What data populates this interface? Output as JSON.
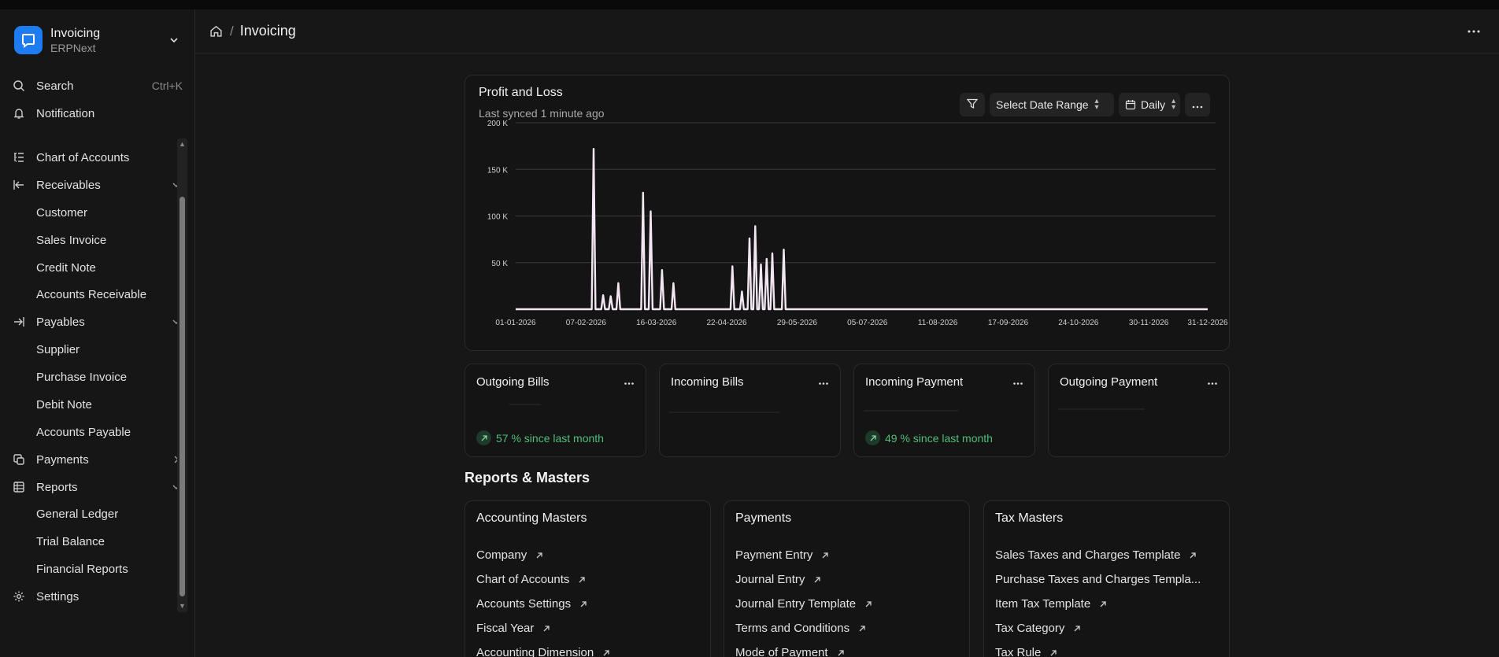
{
  "app": {
    "title": "Invoicing",
    "subtitle": "ERPNext"
  },
  "sidebar": {
    "search_label": "Search",
    "search_shortcut": "Ctrl+K",
    "notification_label": "Notification",
    "items": [
      {
        "label": "Chart of Accounts",
        "icon": "tree-icon",
        "level": 0
      },
      {
        "label": "Receivables",
        "icon": "arrow-left-bar-icon",
        "level": 0,
        "expanded": true
      },
      {
        "label": "Customer",
        "level": 1
      },
      {
        "label": "Sales Invoice",
        "level": 1
      },
      {
        "label": "Credit Note",
        "level": 1
      },
      {
        "label": "Accounts Receivable",
        "level": 1
      },
      {
        "label": "Payables",
        "icon": "arrow-right-bar-icon",
        "level": 0,
        "expanded": true
      },
      {
        "label": "Supplier",
        "level": 1
      },
      {
        "label": "Purchase Invoice",
        "level": 1
      },
      {
        "label": "Debit Note",
        "level": 1
      },
      {
        "label": "Accounts Payable",
        "level": 1
      },
      {
        "label": "Payments",
        "icon": "payments-icon",
        "level": 0,
        "expanded": false
      },
      {
        "label": "Reports",
        "icon": "table-icon",
        "level": 0,
        "expanded": true
      },
      {
        "label": "General Ledger",
        "level": 1
      },
      {
        "label": "Trial Balance",
        "level": 1
      },
      {
        "label": "Financial Reports",
        "level": 1
      },
      {
        "label": "Settings",
        "icon": "gear-icon",
        "level": 0
      }
    ]
  },
  "header": {
    "breadcrumb": "Invoicing"
  },
  "profit_loss": {
    "title": "Profit and Loss",
    "synced": "Last synced 1 minute ago",
    "date_range_label": "Select Date Range",
    "interval_label": "Daily"
  },
  "chart_data": {
    "type": "line",
    "title": "Profit and Loss",
    "x_range": [
      "01-01-2026",
      "31-12-2026"
    ],
    "x_tick_labels": [
      "01-01-2026",
      "07-02-2026",
      "16-03-2026",
      "22-04-2026",
      "29-05-2026",
      "05-07-2026",
      "11-08-2026",
      "17-09-2026",
      "24-10-2026",
      "30-11-2026",
      "31-12-2026"
    ],
    "y_tick_labels": [
      "50 K",
      "100 K",
      "150 K",
      "200 K"
    ],
    "ylim": [
      0,
      200000
    ],
    "grid": true,
    "series": [
      {
        "color": "#f3e6f3",
        "points": [
          [
            "01-01-2026",
            0
          ],
          [
            "10-02-2026",
            0
          ],
          [
            "11-02-2026",
            172000
          ],
          [
            "12-02-2026",
            0
          ],
          [
            "15-02-2026",
            0
          ],
          [
            "16-02-2026",
            15000
          ],
          [
            "17-02-2026",
            0
          ],
          [
            "19-02-2026",
            0
          ],
          [
            "20-02-2026",
            14000
          ],
          [
            "21-02-2026",
            0
          ],
          [
            "23-02-2026",
            0
          ],
          [
            "24-02-2026",
            28000
          ],
          [
            "25-02-2026",
            0
          ],
          [
            "08-03-2026",
            0
          ],
          [
            "09-03-2026",
            125000
          ],
          [
            "10-03-2026",
            0
          ],
          [
            "12-03-2026",
            0
          ],
          [
            "13-03-2026",
            105000
          ],
          [
            "14-03-2026",
            0
          ],
          [
            "18-03-2026",
            0
          ],
          [
            "19-03-2026",
            42000
          ],
          [
            "20-03-2026",
            0
          ],
          [
            "24-03-2026",
            0
          ],
          [
            "25-03-2026",
            28000
          ],
          [
            "26-03-2026",
            0
          ],
          [
            "24-04-2026",
            0
          ],
          [
            "25-04-2026",
            46000
          ],
          [
            "26-04-2026",
            0
          ],
          [
            "29-04-2026",
            0
          ],
          [
            "30-04-2026",
            19000
          ],
          [
            "01-05-2026",
            0
          ],
          [
            "03-05-2026",
            0
          ],
          [
            "04-05-2026",
            76000
          ],
          [
            "05-05-2026",
            0
          ],
          [
            "06-05-2026",
            0
          ],
          [
            "07-05-2026",
            89000
          ],
          [
            "08-05-2026",
            0
          ],
          [
            "09-05-2026",
            0
          ],
          [
            "10-05-2026",
            48000
          ],
          [
            "11-05-2026",
            0
          ],
          [
            "12-05-2026",
            0
          ],
          [
            "13-05-2026",
            54000
          ],
          [
            "14-05-2026",
            0
          ],
          [
            "15-05-2026",
            0
          ],
          [
            "16-05-2026",
            60000
          ],
          [
            "17-05-2026",
            0
          ],
          [
            "21-05-2026",
            0
          ],
          [
            "22-05-2026",
            64000
          ],
          [
            "23-05-2026",
            0
          ],
          [
            "31-12-2026",
            0
          ]
        ]
      }
    ]
  },
  "stats": [
    {
      "title": "Outgoing Bills",
      "trend": "57 % since last month"
    },
    {
      "title": "Incoming Bills",
      "trend": ""
    },
    {
      "title": "Incoming Payment",
      "trend": "49 % since last month"
    },
    {
      "title": "Outgoing Payment",
      "trend": ""
    }
  ],
  "reports_title": "Reports & Masters",
  "reports": [
    {
      "title": "Accounting Masters",
      "links": [
        "Company",
        "Chart of Accounts",
        "Accounts Settings",
        "Fiscal Year",
        "Accounting Dimension"
      ]
    },
    {
      "title": "Payments",
      "links": [
        "Payment Entry",
        "Journal Entry",
        "Journal Entry Template",
        "Terms and Conditions",
        "Mode of Payment"
      ]
    },
    {
      "title": "Tax Masters",
      "links": [
        "Sales Taxes and Charges Template",
        "Purchase Taxes and Charges Templa...",
        "Item Tax Template",
        "Tax Category",
        "Tax Rule"
      ]
    }
  ],
  "colors": {
    "accent": "#1e7cf2",
    "trend_up": "#4fbf7a",
    "line": "#f3e6f3"
  }
}
